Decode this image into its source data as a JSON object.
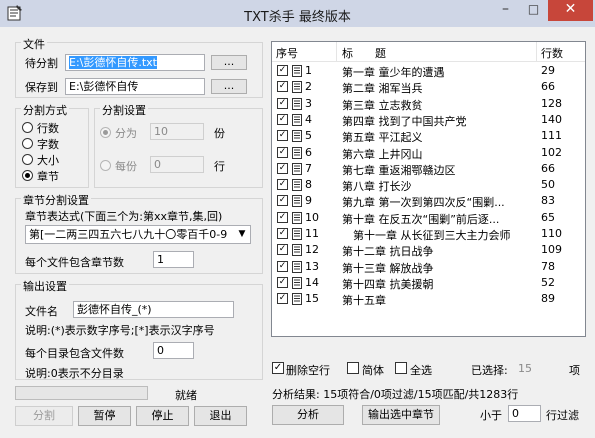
{
  "window": {
    "title": "TXT杀手 最终版本",
    "minimize": "–",
    "maximize": "□",
    "close": "✕"
  },
  "file": {
    "group_title": "文件",
    "split_label": "待分割",
    "split_value": "E:\\彭德怀自传.txt",
    "save_label": "保存到",
    "save_value": "E:\\彭德怀自传",
    "browse": "..."
  },
  "split_mode": {
    "group_title": "分割方式",
    "options": [
      "行数",
      "字数",
      "大小",
      "章节"
    ],
    "selected": "章节"
  },
  "split_settings": {
    "group_title": "分割设置",
    "parts_label": "分为",
    "parts_value": "10",
    "parts_unit": "份",
    "lines_label": "每份",
    "lines_value": "0",
    "lines_unit": "行"
  },
  "chapter": {
    "group_title": "章节分割设置",
    "regex_label": "章节表达式(下面三个为:第xx章节,集,回)",
    "regex_value": "第[一二两三四五六七八九十〇零百千0-9",
    "per_file_label": "每个文件包含章节数",
    "per_file_value": "1"
  },
  "output": {
    "group_title": "输出设置",
    "filename_label": "文件名",
    "filename_value": "彭德怀自传_(*)",
    "note1": "说明:(*)表示数字序号;[*]表示汉字序号",
    "per_dir_label": "每个目录包含文件数",
    "per_dir_value": "0",
    "note2": "说明:0表示不分目录"
  },
  "status": {
    "text": "就绪",
    "progress": 0
  },
  "buttons": {
    "split": "分割",
    "pause": "暂停",
    "stop": "停止",
    "exit": "退出",
    "analyze": "分析",
    "export_selected": "输出选中章节"
  },
  "table": {
    "headers": {
      "seq": "序号",
      "title": "标　　题",
      "count": "行数"
    },
    "rows": [
      {
        "seq": "1",
        "title": "第一章 童少年的遭遇",
        "count": "29"
      },
      {
        "seq": "2",
        "title": "第二章 湘军当兵",
        "count": "66"
      },
      {
        "seq": "3",
        "title": "第三章 立志救贫",
        "count": "128"
      },
      {
        "seq": "4",
        "title": "第四章 找到了中国共产党",
        "count": "140"
      },
      {
        "seq": "5",
        "title": "第五章 平江起义",
        "count": "111"
      },
      {
        "seq": "6",
        "title": "第六章 上井冈山",
        "count": "102"
      },
      {
        "seq": "7",
        "title": "第七章 重返湘鄂赣边区",
        "count": "66"
      },
      {
        "seq": "8",
        "title": "第八章 打长沙",
        "count": "50"
      },
      {
        "seq": "9",
        "title": "第九章 第一次到第四次反“围剿...",
        "count": "83"
      },
      {
        "seq": "10",
        "title": "第十章 在反五次“围剿”前后逐...",
        "count": "65"
      },
      {
        "seq": "11",
        "title": "　第十一章 从长征到三大主力会师",
        "count": "110"
      },
      {
        "seq": "12",
        "title": "第十二章 抗日战争",
        "count": "109"
      },
      {
        "seq": "13",
        "title": "第十三章 解放战争",
        "count": "78"
      },
      {
        "seq": "14",
        "title": "第十四章 抗美援朝",
        "count": "52"
      },
      {
        "seq": "15",
        "title": "第十五章",
        "count": "89"
      }
    ]
  },
  "options": {
    "remove_blank": "删除空行",
    "simplified": "简体",
    "select_all": "全选",
    "selected_label": "已选择:",
    "selected_count": "15",
    "selected_unit": "项"
  },
  "analysis": {
    "result": "分析结果: 15项符合/0项过滤/15项匹配/共1283行",
    "min_label": "小于",
    "min_value": "0",
    "filter_label": "行过滤"
  },
  "colors": {
    "titlebar": "#cfd6e6",
    "close": "#c7463a",
    "window": "#f0f0f0",
    "selection": "#3399ff"
  }
}
